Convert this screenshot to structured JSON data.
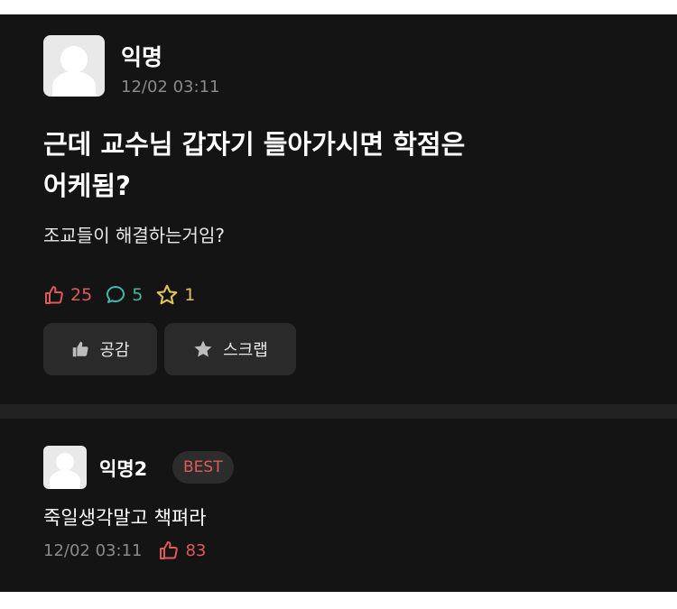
{
  "post": {
    "author": "익명",
    "timestamp": "12/02 03:11",
    "title_line1": "근데 교수님 갑자기 들아가시면 학점은",
    "title_line2": "어케됨?",
    "body": "조교들이 해결하는거임?",
    "stats": {
      "likes": "25",
      "comments": "5",
      "scraps": "1"
    },
    "buttons": {
      "like_label": "공감",
      "scrap_label": "스크랩"
    }
  },
  "comment": {
    "author": "익명2",
    "badge": "BEST",
    "text": "죽일생각말고 책펴라",
    "timestamp": "12/02 03:11",
    "likes": "83"
  },
  "colors": {
    "background": "#141414",
    "like": "#e05a5a",
    "comment": "#3fb8a8",
    "scrap": "#e0c15a"
  },
  "icons": [
    "thumbs-up-icon",
    "speech-bubble-icon",
    "star-icon",
    "avatar-icon"
  ]
}
